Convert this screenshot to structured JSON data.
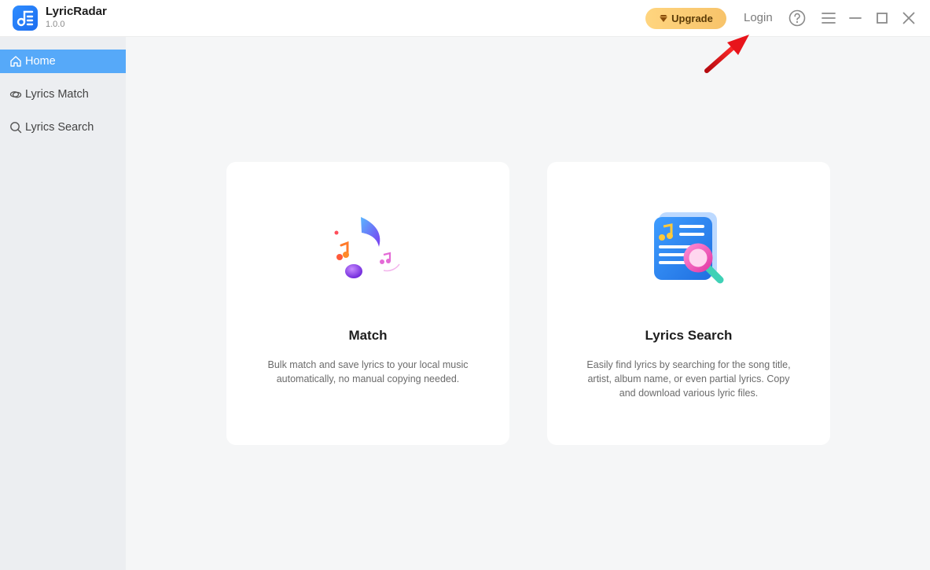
{
  "app": {
    "name": "LyricRadar",
    "version": "1.0.0"
  },
  "titlebar": {
    "upgrade_label": "Upgrade",
    "login_label": "Login",
    "icons": [
      "help-icon",
      "menu-icon",
      "minimize-icon",
      "maximize-icon",
      "close-icon"
    ]
  },
  "sidebar": {
    "items": [
      {
        "label": "Home",
        "icon": "home-icon",
        "active": true
      },
      {
        "label": "Lyrics Match",
        "icon": "link-icon",
        "active": false
      },
      {
        "label": "Lyrics Search",
        "icon": "search-icon",
        "active": false
      }
    ]
  },
  "cards": [
    {
      "title": "Match",
      "description": "Bulk match and save lyrics to your local music automatically, no manual copying needed.",
      "icon": "music-notes-icon"
    },
    {
      "title": "Lyrics Search",
      "description": "Easily find lyrics by searching for the song title, artist, album name, or even partial lyrics. Copy and download various lyric files.",
      "icon": "lyrics-magnifier-icon"
    }
  ],
  "colors": {
    "accent": "#56a9f9",
    "upgrade": "#f7c36a",
    "sidebar_bg": "#eceef1",
    "content_bg": "#f5f6f7",
    "annotation_arrow": "#e8141b"
  }
}
